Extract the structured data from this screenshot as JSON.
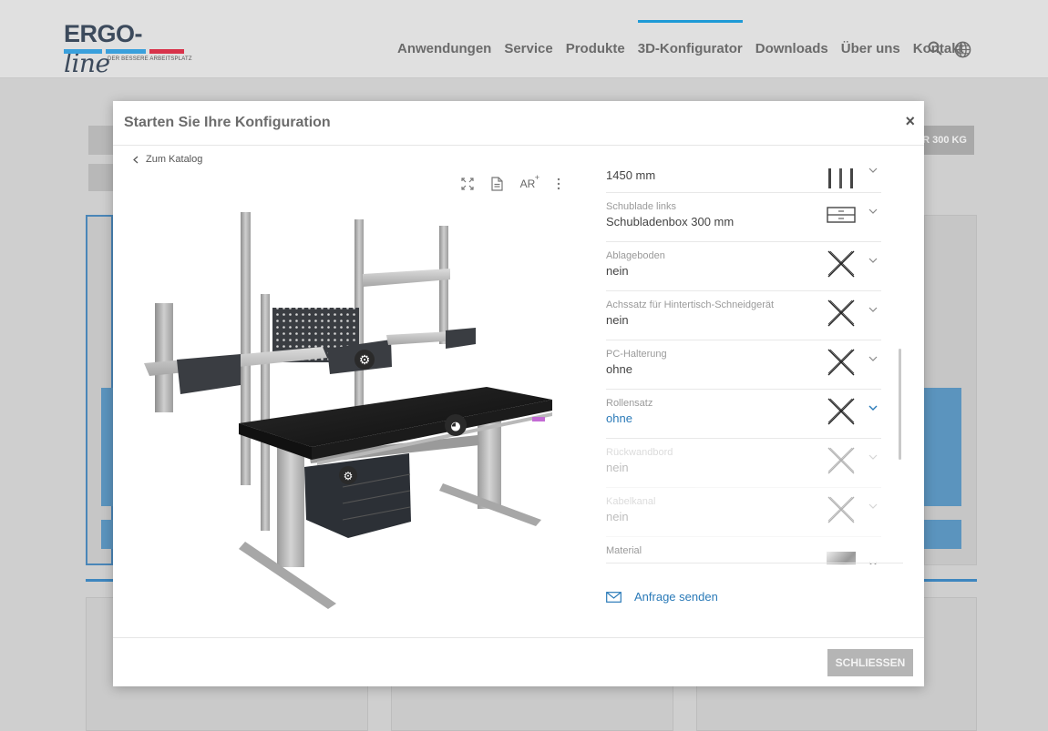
{
  "site": {
    "logo": {
      "word": "ERGO-",
      "script": "line",
      "tagline": "DER BESSERE ARBEITSPLATZ",
      "colors": [
        "#3aa0dc",
        "#3aa0dc",
        "#d8334a"
      ]
    },
    "nav": [
      "Anwendungen",
      "Service",
      "Produkte",
      "3D-Konfigurator",
      "Downloads",
      "Über uns",
      "Kontakt"
    ],
    "active_nav": "3D-Konfigurator",
    "icons": [
      "search-icon",
      "globe-icon"
    ],
    "bg_tag": "R 300 KG"
  },
  "modal": {
    "title": "Starten Sie Ihre Konfiguration",
    "close_symbol": "×",
    "back_label": "Zum Katalog",
    "toolbar": [
      "fullscreen-icon",
      "document-icon",
      "ar-icon",
      "more-icon"
    ],
    "ar_label": "AR",
    "options": [
      {
        "label": "",
        "value": "1450 mm",
        "thumb": "uprights"
      },
      {
        "label": "Schublade links",
        "value": "Schubladenbox 300 mm",
        "thumb": "drawer"
      },
      {
        "label": "Ablageboden",
        "value": "nein",
        "thumb": "cross"
      },
      {
        "label": "Achssatz für Hintertisch-Schneidgerät",
        "value": "nein",
        "thumb": "cross"
      },
      {
        "label": "PC-Halterung",
        "value": "ohne",
        "thumb": "cross"
      },
      {
        "label": "Rollensatz",
        "value": "ohne",
        "thumb": "cross",
        "highlight": true
      },
      {
        "label": "Rückwandbord",
        "value": "nein",
        "thumb": "cross",
        "faded": true
      },
      {
        "label": "Kabelkanal",
        "value": "nein",
        "thumb": "cross",
        "faded": true
      },
      {
        "label": "Material",
        "value": "",
        "thumb": "metal"
      }
    ],
    "send_label": "Anfrage senden",
    "footer_button": "SCHLIESSEN",
    "accent": "#2a7ab8"
  }
}
